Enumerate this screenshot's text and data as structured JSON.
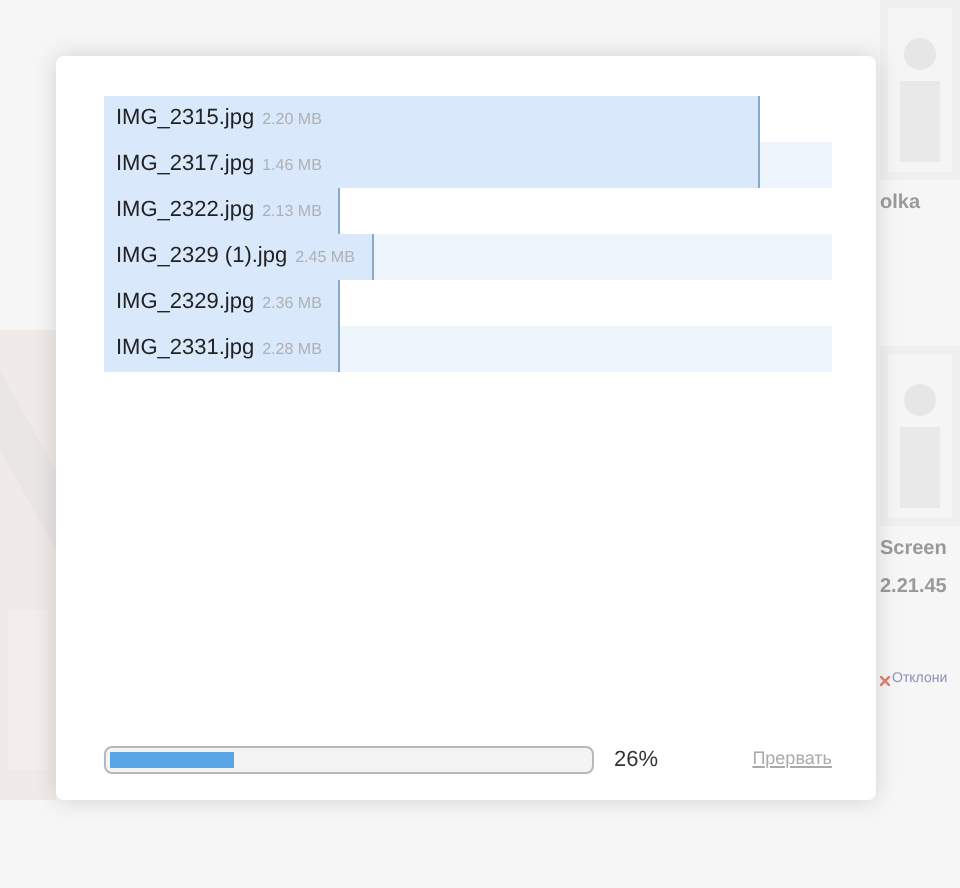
{
  "background": {
    "right_items": [
      {
        "kind": "picture"
      },
      {
        "kind": "title",
        "text": "olka"
      },
      {
        "kind": "picture"
      },
      {
        "kind": "title",
        "text": "Screen"
      },
      {
        "kind": "title",
        "text": "2.21.45"
      },
      {
        "kind": "reject",
        "text": "Отклони"
      }
    ]
  },
  "files": [
    {
      "name": "IMG_2315.jpg",
      "size": "2.20 MB",
      "level": 0.9
    },
    {
      "name": "IMG_2317.jpg",
      "size": "1.46 MB",
      "level": 0.9
    },
    {
      "name": "IMG_2322.jpg",
      "size": "2.13 MB",
      "level": 0.324
    },
    {
      "name": "IMG_2329 (1).jpg",
      "size": "2.45 MB",
      "level": 0.37
    },
    {
      "name": "IMG_2329.jpg",
      "size": "2.36 MB",
      "level": 0.324
    },
    {
      "name": "IMG_2331.jpg",
      "size": "2.28 MB",
      "level": 0.324
    }
  ],
  "progress": {
    "level": 0.26,
    "reading": "26%"
  },
  "cancel_link": "Прервать"
}
